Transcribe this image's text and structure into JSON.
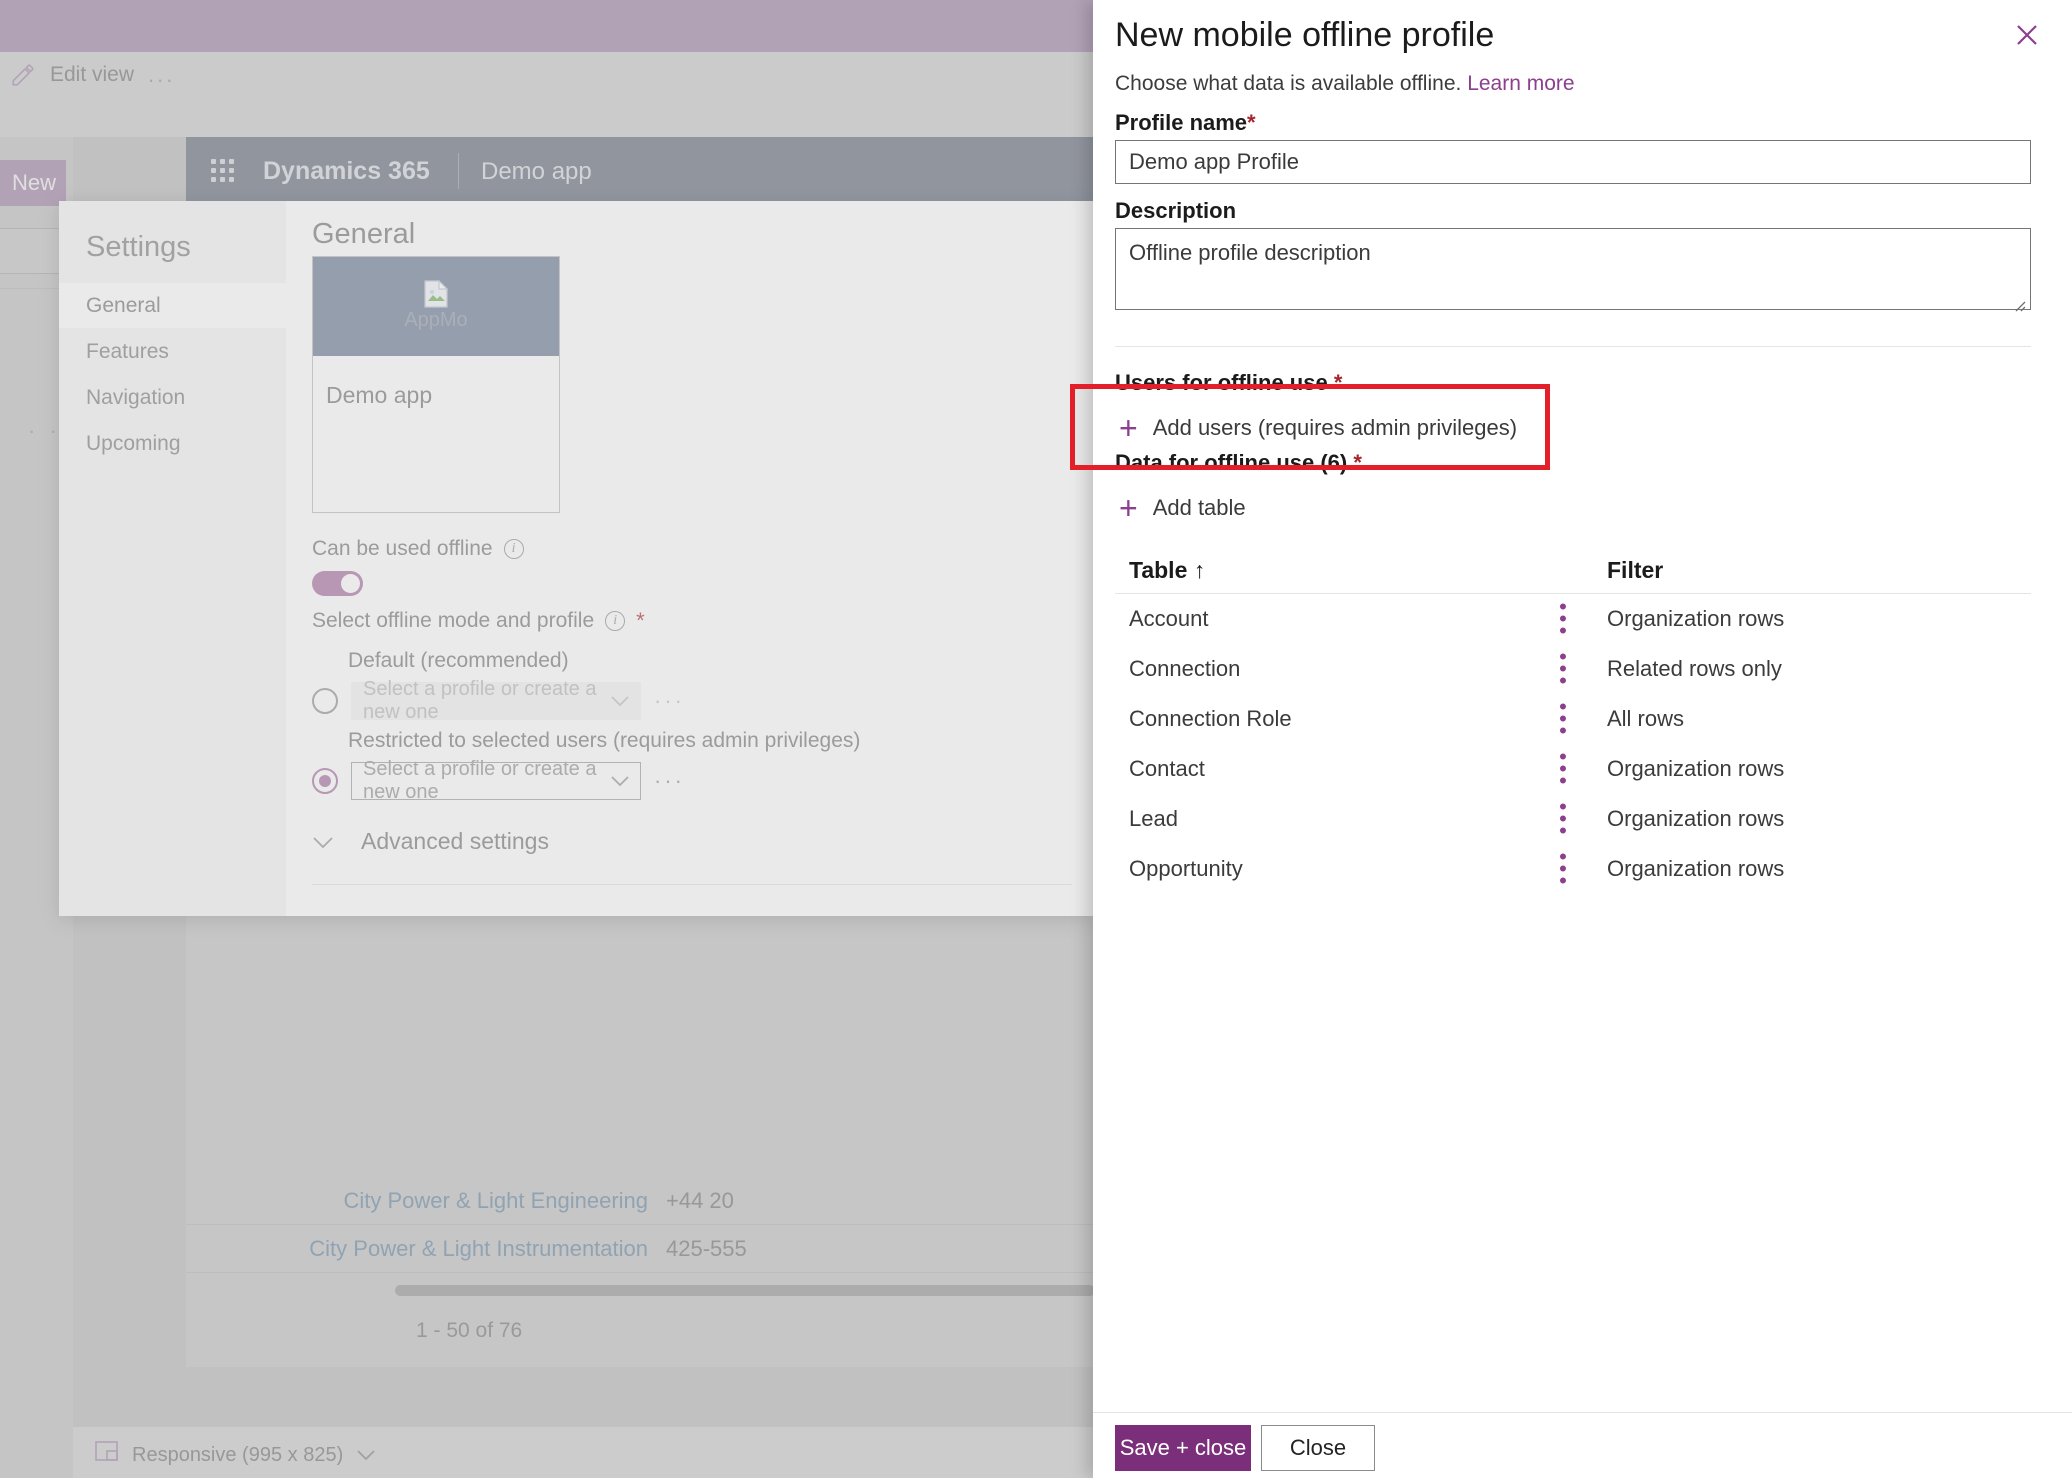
{
  "backdrop": {
    "edit_view_label": "Edit view",
    "overflow_label": "...",
    "new_button_label": "New",
    "app_bar": {
      "product_name": "Dynamics 365",
      "app_name": "Demo app"
    },
    "rows": [
      {
        "name": "City Power & Light Engineering",
        "phone": "+44 20"
      },
      {
        "name": "City Power & Light Instrumentation",
        "phone": "425-555"
      }
    ],
    "record_count": "1 - 50 of 76",
    "responsive_label": "Responsive (995 x 825)"
  },
  "settings_dialog": {
    "nav_title": "Settings",
    "nav_items": [
      {
        "label": "General",
        "active": true
      },
      {
        "label": "Features",
        "active": false
      },
      {
        "label": "Navigation",
        "active": false
      },
      {
        "label": "Upcoming",
        "active": false
      }
    ],
    "heading": "General",
    "thumbnail": {
      "broken_image_label": "AppMo",
      "app_name": "Demo app"
    },
    "can_be_used_offline_label": "Can be used offline",
    "can_be_used_offline_value": "on",
    "select_mode_label": "Select offline mode and profile",
    "required_marker": "*",
    "options": [
      {
        "label": "Default (recommended)",
        "selected": false,
        "combo_value": "Select a profile or create a new one",
        "overflow_label": "···"
      },
      {
        "label": "Restricted to selected users (requires admin privileges)",
        "selected": true,
        "combo_value": "Select a profile or create a new one",
        "overflow_label": "···"
      }
    ],
    "advanced_settings_label": "Advanced settings"
  },
  "panel": {
    "title": "New mobile offline profile",
    "subtitle_text": "Choose what data is available offline.",
    "learn_more_label": "Learn more",
    "close_label": "×",
    "profile_name": {
      "label": "Profile name",
      "required": "*",
      "value": "Demo app Profile"
    },
    "description": {
      "label": "Description",
      "value": "Offline profile description"
    },
    "users_section": {
      "label": "Users for offline use",
      "required": "*",
      "add_label": "Add users (requires admin privileges)",
      "plus": "+"
    },
    "data_section": {
      "label": "Data for offline use (6)",
      "required": "*",
      "add_label": "Add table",
      "plus": "+"
    },
    "table": {
      "columns": [
        "Table ↑",
        "Filter"
      ],
      "sort_indicator": "↑",
      "rows": [
        {
          "table": "Account",
          "filter": "Organization rows"
        },
        {
          "table": "Connection",
          "filter": "Related rows only"
        },
        {
          "table": "Connection Role",
          "filter": "All rows"
        },
        {
          "table": "Contact",
          "filter": "Organization rows"
        },
        {
          "table": "Lead",
          "filter": "Organization rows"
        },
        {
          "table": "Opportunity",
          "filter": "Organization rows"
        }
      ]
    },
    "footer": {
      "save_label": "Save + close",
      "close_label": "Close"
    }
  },
  "colors": {
    "brand_purple": "#7b2f7b",
    "accent_purple": "#8c3f8c",
    "toggle_on": "#a5699f",
    "required_red": "#a4262c",
    "highlight_red": "#e3202a",
    "d365_bar": "#5d6576",
    "link_blue": "#5c7e9b"
  }
}
